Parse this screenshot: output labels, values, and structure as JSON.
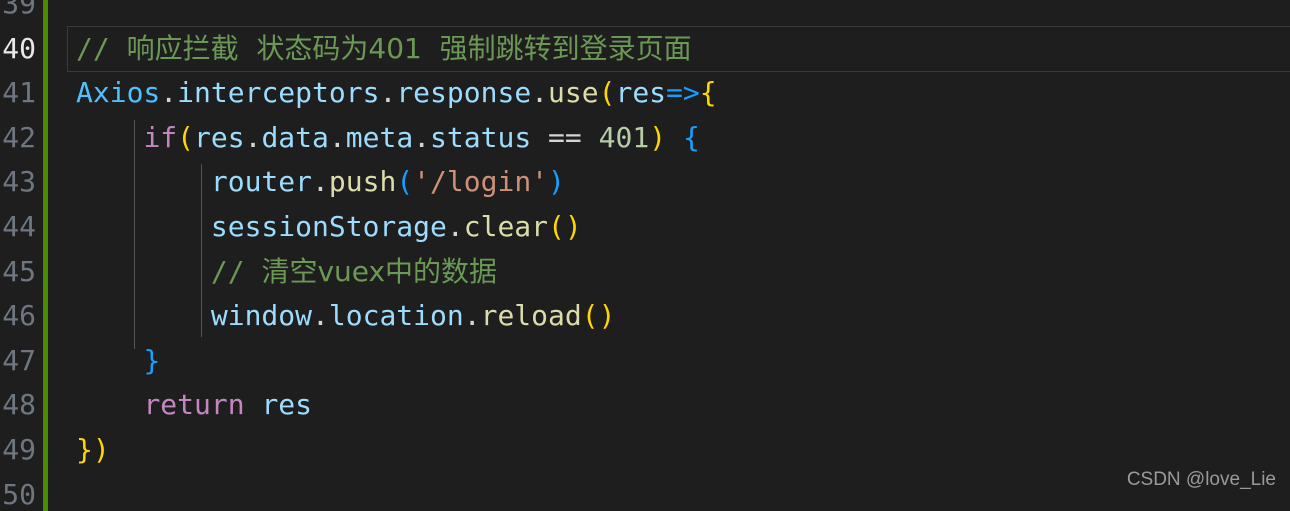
{
  "editor": {
    "theme": "dark-plus",
    "background": "#1e1e1e",
    "active_line_number": 40,
    "git_modified_color": "#4b8b00",
    "line_number_color": "#6e7681",
    "active_line_number_color": "#e8e8e8"
  },
  "gutter": {
    "line_numbers": [
      "39",
      "40",
      "41",
      "42",
      "43",
      "44",
      "45",
      "46",
      "47",
      "48",
      "49",
      "50"
    ]
  },
  "code": {
    "lines": [
      {
        "number": "39",
        "text": ""
      },
      {
        "number": "40",
        "text": "// 响应拦截  状态码为401  强制跳转到登录页面"
      },
      {
        "number": "41",
        "text": "Axios.interceptors.response.use(res=>{"
      },
      {
        "number": "42",
        "text": "    if(res.data.meta.status == 401) {"
      },
      {
        "number": "43",
        "text": "        router.push('/login')"
      },
      {
        "number": "44",
        "text": "        sessionStorage.clear()"
      },
      {
        "number": "45",
        "text": "        // 清空vuex中的数据"
      },
      {
        "number": "46",
        "text": "        window.location.reload()"
      },
      {
        "number": "47",
        "text": "    }"
      },
      {
        "number": "48",
        "text": "    return res"
      },
      {
        "number": "49",
        "text": "})"
      },
      {
        "number": "50",
        "text": ""
      }
    ],
    "tokens": {
      "l40": [
        {
          "s": "// ",
          "c": "t-comment"
        },
        {
          "s": "响应拦截  状态码为401  强制跳转到登录页面",
          "c": "t-comment cjk"
        }
      ],
      "l41": [
        {
          "s": "Axios",
          "c": "t-class"
        },
        {
          "s": ".",
          "c": "t-plain"
        },
        {
          "s": "interceptors",
          "c": "t-var"
        },
        {
          "s": ".",
          "c": "t-plain"
        },
        {
          "s": "response",
          "c": "t-var"
        },
        {
          "s": ".",
          "c": "t-plain"
        },
        {
          "s": "use",
          "c": "t-func"
        },
        {
          "s": "(",
          "c": "t-p1"
        },
        {
          "s": "res",
          "c": "t-var"
        },
        {
          "s": "=>",
          "c": "t-p3"
        },
        {
          "s": "{",
          "c": "t-p1"
        }
      ],
      "l42": [
        {
          "s": "    ",
          "c": "t-plain"
        },
        {
          "s": "if",
          "c": "t-kw"
        },
        {
          "s": "(",
          "c": "t-p1"
        },
        {
          "s": "res",
          "c": "t-var"
        },
        {
          "s": ".",
          "c": "t-plain"
        },
        {
          "s": "data",
          "c": "t-var"
        },
        {
          "s": ".",
          "c": "t-plain"
        },
        {
          "s": "meta",
          "c": "t-var"
        },
        {
          "s": ".",
          "c": "t-plain"
        },
        {
          "s": "status",
          "c": "t-var"
        },
        {
          "s": " == ",
          "c": "t-op"
        },
        {
          "s": "401",
          "c": "t-num"
        },
        {
          "s": ")",
          "c": "t-p1"
        },
        {
          "s": " ",
          "c": "t-plain"
        },
        {
          "s": "{",
          "c": "t-p3"
        }
      ],
      "l43": [
        {
          "s": "        ",
          "c": "t-plain"
        },
        {
          "s": "router",
          "c": "t-var"
        },
        {
          "s": ".",
          "c": "t-plain"
        },
        {
          "s": "push",
          "c": "t-func"
        },
        {
          "s": "(",
          "c": "t-p3"
        },
        {
          "s": "'/login'",
          "c": "t-str"
        },
        {
          "s": ")",
          "c": "t-p3"
        }
      ],
      "l44": [
        {
          "s": "        ",
          "c": "t-plain"
        },
        {
          "s": "sessionStorage",
          "c": "t-var"
        },
        {
          "s": ".",
          "c": "t-plain"
        },
        {
          "s": "clear",
          "c": "t-func"
        },
        {
          "s": "()",
          "c": "t-p1"
        }
      ],
      "l45": [
        {
          "s": "        ",
          "c": "t-plain"
        },
        {
          "s": "// ",
          "c": "t-comment"
        },
        {
          "s": "清空vuex中的数据",
          "c": "t-comment cjk"
        }
      ],
      "l46": [
        {
          "s": "        ",
          "c": "t-plain"
        },
        {
          "s": "window",
          "c": "t-var"
        },
        {
          "s": ".",
          "c": "t-plain"
        },
        {
          "s": "location",
          "c": "t-var"
        },
        {
          "s": ".",
          "c": "t-plain"
        },
        {
          "s": "reload",
          "c": "t-func"
        },
        {
          "s": "()",
          "c": "t-p1"
        }
      ],
      "l47": [
        {
          "s": "    ",
          "c": "t-plain"
        },
        {
          "s": "}",
          "c": "t-p3"
        }
      ],
      "l48": [
        {
          "s": "    ",
          "c": "t-plain"
        },
        {
          "s": "return",
          "c": "t-kw"
        },
        {
          "s": " ",
          "c": "t-plain"
        },
        {
          "s": "res",
          "c": "t-var"
        }
      ],
      "l49": [
        {
          "s": "}",
          "c": "t-p1"
        },
        {
          "s": ")",
          "c": "t-p1"
        }
      ],
      "l50": []
    }
  },
  "watermark": {
    "text": "CSDN @love_Lie"
  }
}
